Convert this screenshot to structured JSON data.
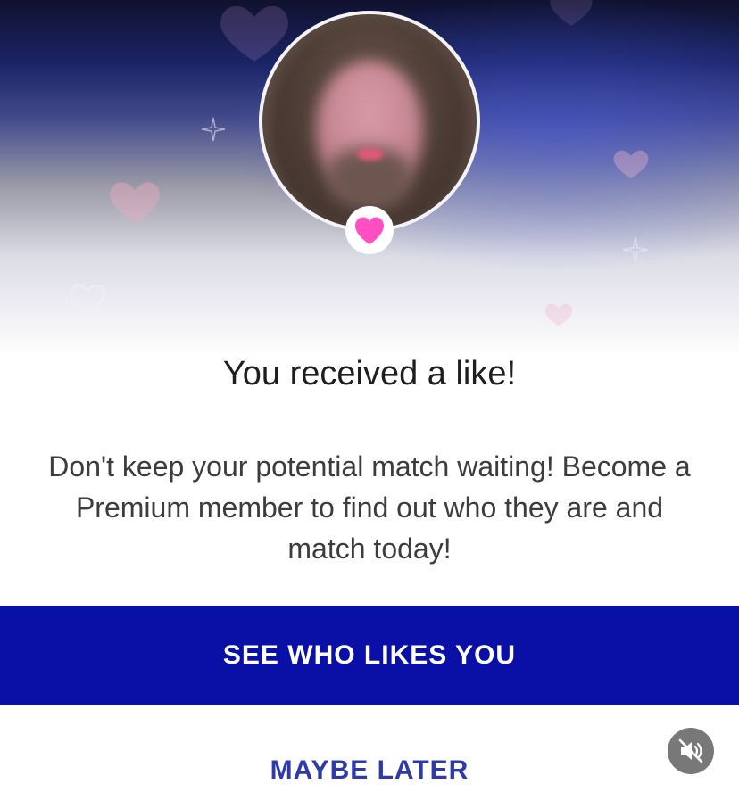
{
  "dialog": {
    "title": "You received a like!",
    "message": "Don't keep your potential match waiting! Become a Premium member to find out who they are and match today!",
    "primary_button_label": "SEE WHO LIKES YOU",
    "secondary_button_label": "MAYBE LATER"
  },
  "icons": {
    "badge": "heart-icon",
    "mute": "speaker-muted-icon"
  },
  "colors": {
    "primary_button": "#0a0fa6",
    "secondary_text": "#2e3aa8",
    "heart_badge": "#ff4fc3"
  }
}
